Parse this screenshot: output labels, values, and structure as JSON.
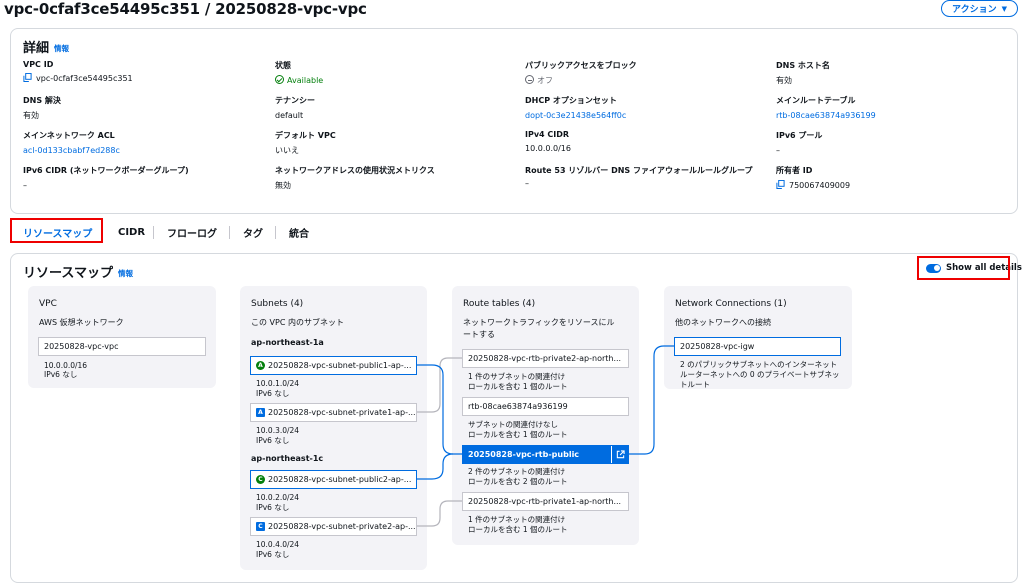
{
  "header": {
    "title": "vpc-0cfaf3ce54495c351 / 20250828-vpc-vpc",
    "action_label": "アクション"
  },
  "details": {
    "heading": "詳細",
    "info": "情報",
    "fields": {
      "vpc_id": {
        "label": "VPC ID",
        "value": "vpc-0cfaf3ce54495c351"
      },
      "state": {
        "label": "状態",
        "value": "Available"
      },
      "block_public": {
        "label": "パブリックアクセスをブロック",
        "value": "オフ"
      },
      "dns_hostname": {
        "label": "DNS ホスト名",
        "value": "有効"
      },
      "dns_resolution": {
        "label": "DNS 解決",
        "value": "有効"
      },
      "tenancy": {
        "label": "テナンシー",
        "value": "default"
      },
      "dhcp": {
        "label": "DHCP オプションセット",
        "value": "dopt-0c3e21438e564ff0c"
      },
      "main_route_table": {
        "label": "メインルートテーブル",
        "value": "rtb-08cae63874a936199"
      },
      "main_acl": {
        "label": "メインネットワーク ACL",
        "value": "acl-0d133cbabf7ed288c"
      },
      "default_vpc": {
        "label": "デフォルト VPC",
        "value": "いいえ"
      },
      "ipv4_cidr": {
        "label": "IPv4 CIDR",
        "value": "10.0.0.0/16"
      },
      "ipv6_pool": {
        "label": "IPv6 プール",
        "value": "–"
      },
      "ipv6_cidr": {
        "label": "IPv6 CIDR (ネットワークボーダーグループ)",
        "value": "–"
      },
      "net_usage": {
        "label": "ネットワークアドレスの使用状況メトリクス",
        "value": "無効"
      },
      "route53": {
        "label": "Route 53 リゾルバー DNS ファイアウォールルールグループ",
        "value": "–"
      },
      "owner": {
        "label": "所有者 ID",
        "value": "750067409009"
      }
    }
  },
  "tabs": [
    "リソースマップ",
    "CIDR",
    "フローログ",
    "タグ",
    "統合"
  ],
  "resource_map": {
    "heading": "リソースマップ",
    "info": "情報",
    "toggle_label": "Show all details",
    "vpc": {
      "title": "VPC",
      "subtitle": "AWS 仮想ネットワーク",
      "node": "20250828-vpc-vpc",
      "note1": "10.0.0.0/16",
      "note2": "IPv6 なし"
    },
    "subnets": {
      "title": "Subnets (4)",
      "subtitle": "この VPC 内のサブネット",
      "az1": "ap-northeast-1a",
      "az2": "ap-northeast-1c",
      "items": [
        {
          "badge": "A",
          "name": "20250828-vpc-subnet-public1-ap-...",
          "cidr": "10.0.1.0/24",
          "ipv6": "IPv6 なし"
        },
        {
          "badge": "A",
          "name": "20250828-vpc-subnet-private1-ap-...",
          "cidr": "10.0.3.0/24",
          "ipv6": "IPv6 なし"
        },
        {
          "badge": "C",
          "name": "20250828-vpc-subnet-public2-ap-...",
          "cidr": "10.0.2.0/24",
          "ipv6": "IPv6 なし"
        },
        {
          "badge": "C",
          "name": "20250828-vpc-subnet-private2-ap-...",
          "cidr": "10.0.4.0/24",
          "ipv6": "IPv6 なし"
        }
      ]
    },
    "route_tables": {
      "title": "Route tables (4)",
      "subtitle1": "ネットワークトラフィックをリソースにル",
      "subtitle2": "ートする",
      "items": [
        {
          "name": "20250828-vpc-rtb-private2-ap-north...",
          "line1": "1 件のサブネットの関連付け",
          "line2": "ローカルを含む 1 個のルート"
        },
        {
          "name": "rtb-08cae63874a936199",
          "line1": "サブネットの関連付けなし",
          "line2": "ローカルを含む 1 個のルート"
        },
        {
          "name": "20250828-vpc-rtb-public",
          "line1": "2 件のサブネットの関連付け",
          "line2": "ローカルを含む 2 個のルート"
        },
        {
          "name": "20250828-vpc-rtb-private1-ap-north...",
          "line1": "1 件のサブネットの関連付け",
          "line2": "ローカルを含む 1 個のルート"
        }
      ]
    },
    "connections": {
      "title": "Network Connections (1)",
      "subtitle": "他のネットワークへの接続",
      "node": "20250828-vpc-igw",
      "note1": "2 のパブリックサブネットへのインターネット",
      "note2": "ルーターネットへの 0 のプライベートサブネッ",
      "note3": "トルート"
    }
  },
  "colors": {
    "accent": "#006ce0",
    "available": "#037f0c",
    "highlight": "#ee0000",
    "public_badge": "#037f0c",
    "private_badge": "#006ce0"
  }
}
